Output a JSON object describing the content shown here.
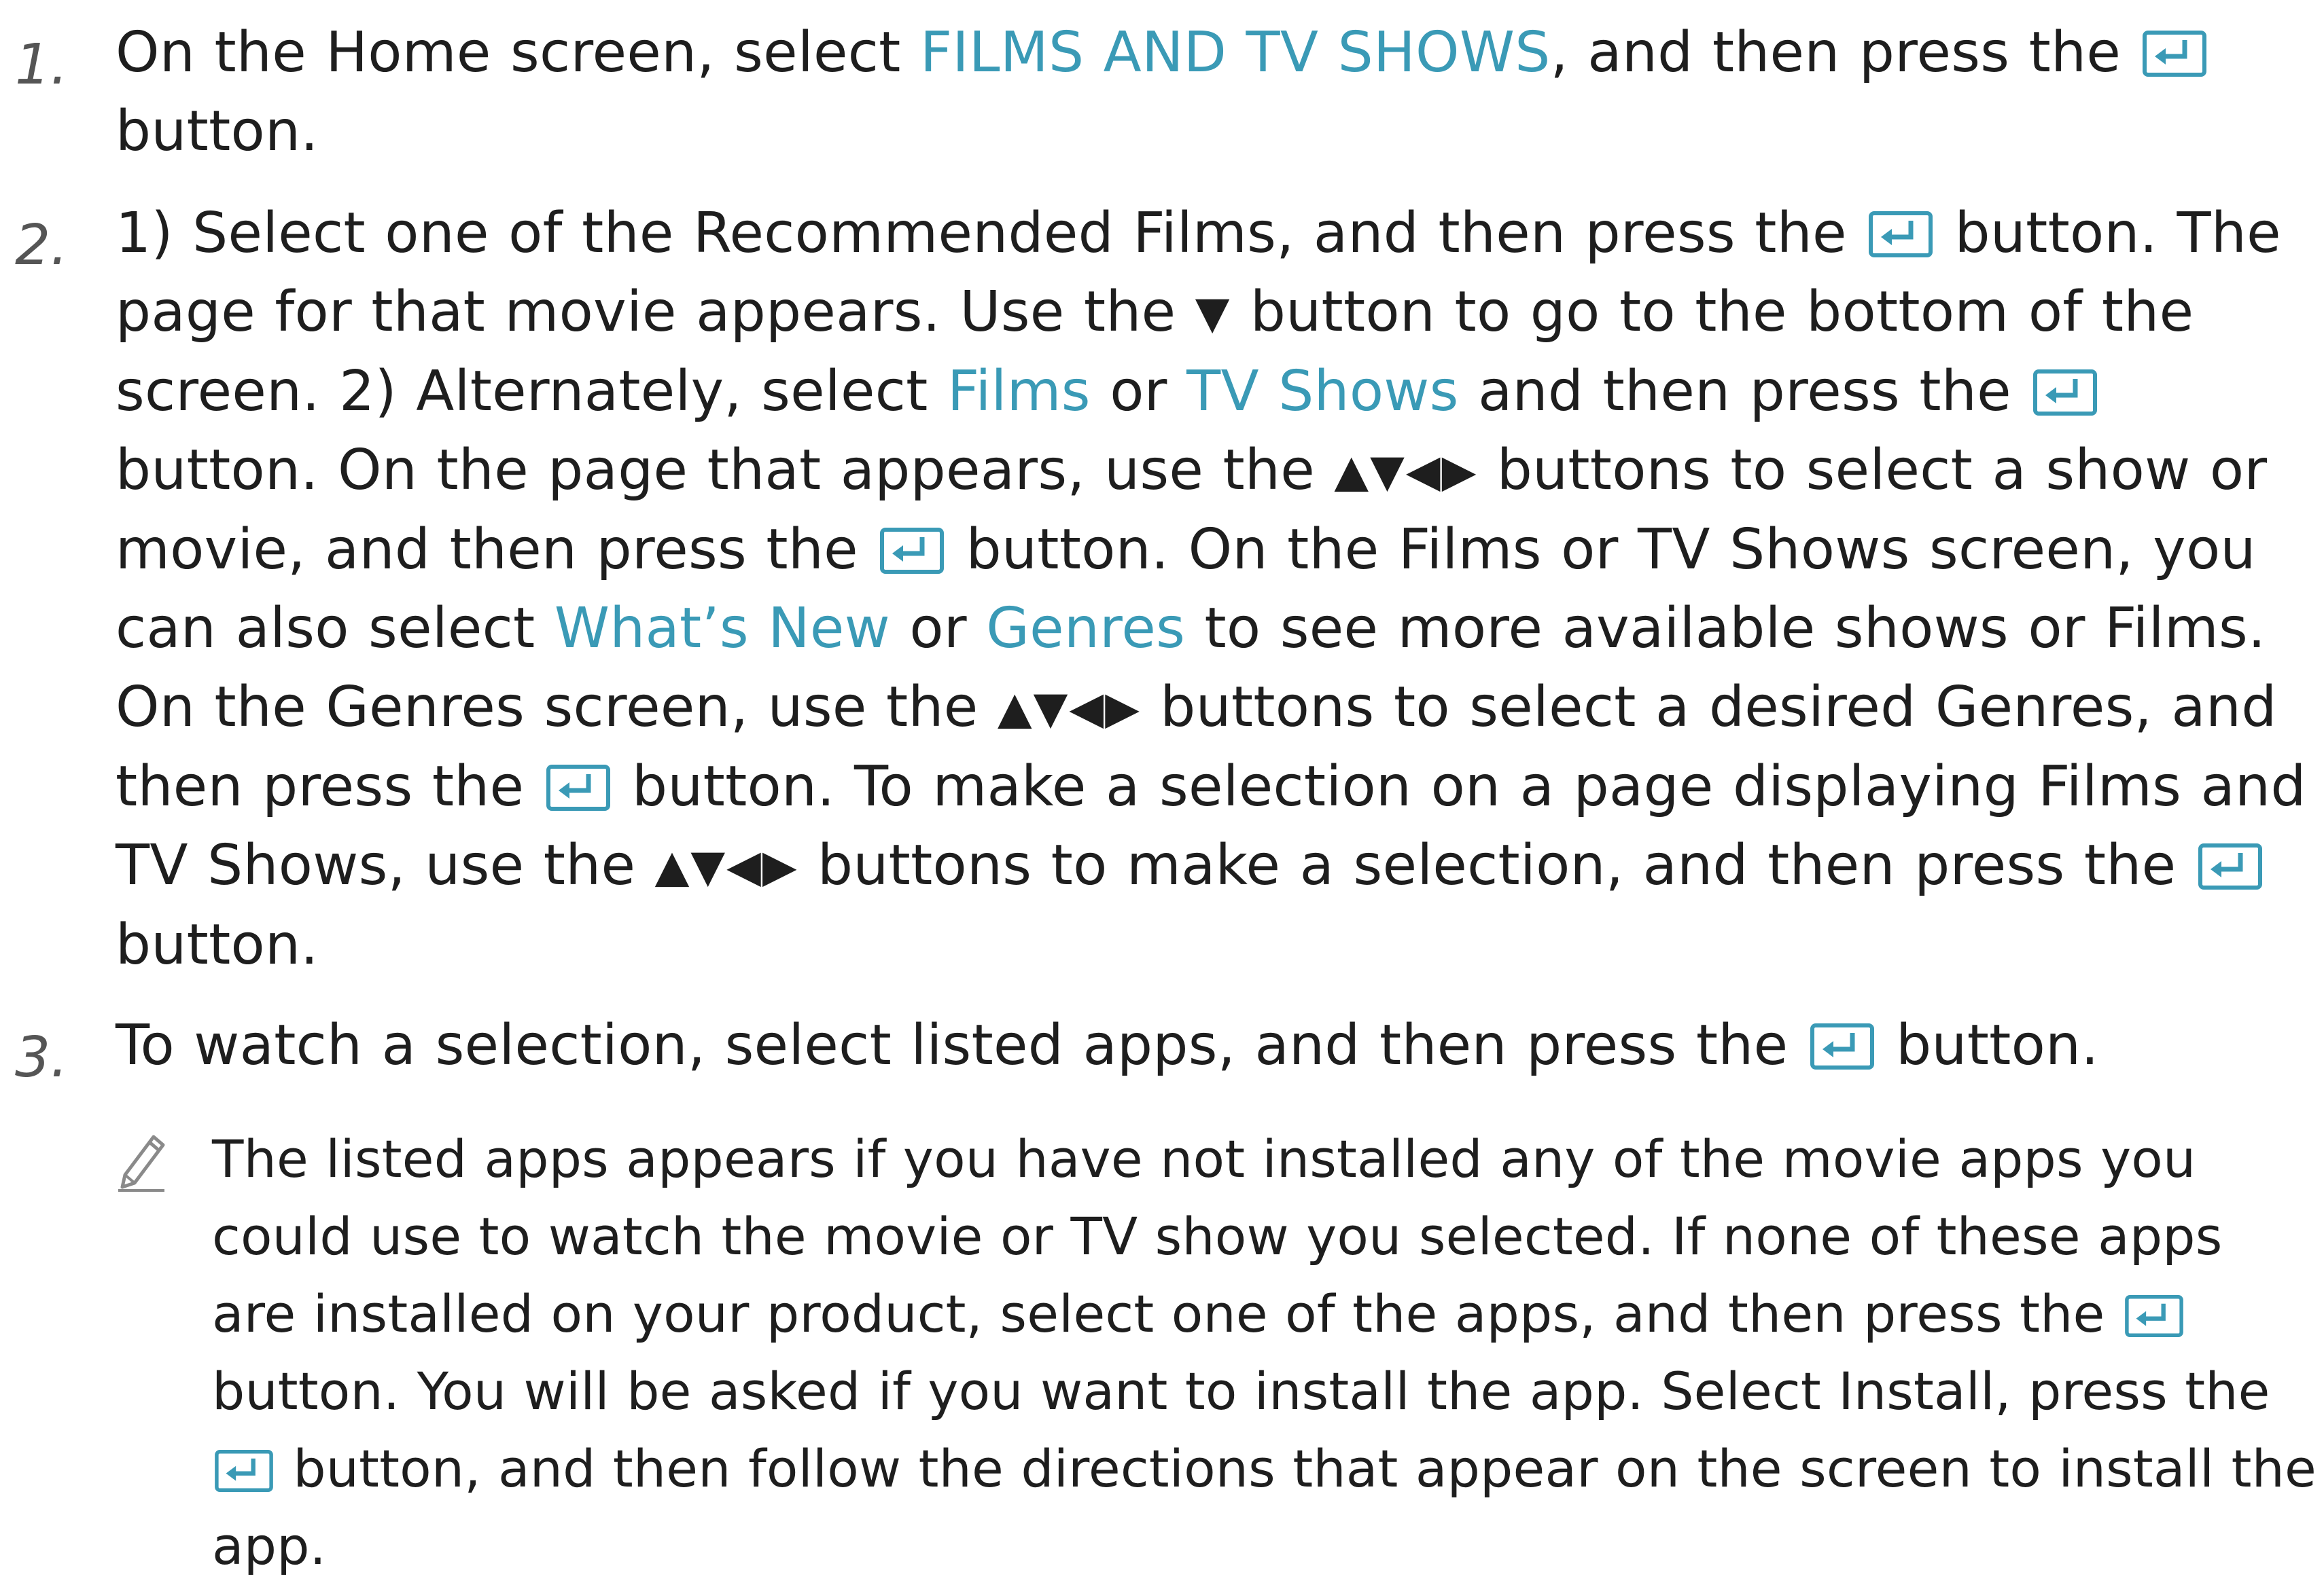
{
  "steps": [
    {
      "number": "1.",
      "s1": "On the Home screen, select ",
      "hl1": "FILMS AND TV SHOWS",
      "s2": ", and then press the ",
      "s3": " button."
    },
    {
      "number": "2.",
      "s1": "1) Select one of the Recommended Films, and then press the ",
      "s2": " button. The page for that movie appears. Use the ",
      "down_arrow": "▼",
      "s3": " button to go to the bottom of the screen. 2) Alternately, select ",
      "hl_films": "Films",
      "s4": " or ",
      "hl_tv": "TV Shows",
      "s5": " and then press the ",
      "s6": " button. On the page that appears, use the ",
      "arrows": "▲▼◀▶",
      "s7": " buttons to select a show or movie, and then press the ",
      "s8": " button. On the Films or TV Shows screen, you can also select ",
      "hl_whats_new": "What’s New",
      "s9": " or ",
      "hl_genres": "Genres",
      "s10": " to see more available shows or Films. On the Genres screen, use the ",
      "s11": " buttons to select a desired Genres, and then press the ",
      "s12": " button. To make a selection on a page displaying Films and TV Shows, use the ",
      "s13": " buttons to make a selection, and then press the ",
      "s14": " button."
    },
    {
      "number": "3.",
      "s1": "To watch a selection, select listed apps, and then press the ",
      "s2": " button."
    }
  ],
  "note": {
    "icon": "pencil-icon",
    "s1": "The listed apps appears if you have not installed any of the movie apps you could use to watch the movie or TV show you selected. If none of these apps are installed on your product, select one of the apps, and then press the ",
    "s2": " button. You will be asked if you want to install the app. Select Install, press the ",
    "s3": " button, and then follow the directions that appear on the screen to install the app."
  },
  "colors": {
    "highlight": "#3a9ab6",
    "text": "#1e1e1e",
    "enter_icon": "#3a9ab6"
  },
  "icons": {
    "enter": "enter-icon",
    "note": "pencil-icon"
  }
}
